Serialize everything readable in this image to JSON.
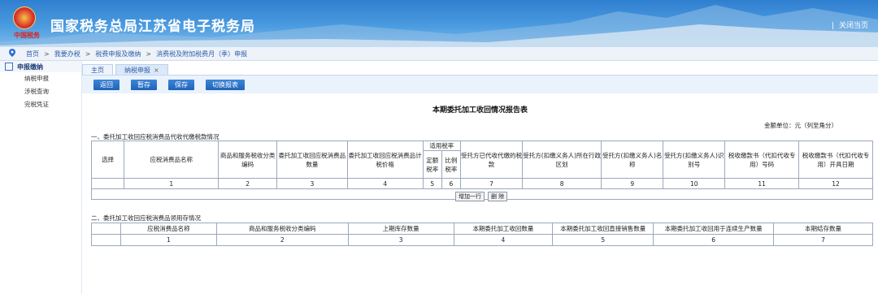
{
  "header": {
    "title": "国家税务总局江苏省电子税务局",
    "emblem_stamp": "中国税务",
    "close_label": "关闭当页",
    "separator": "|"
  },
  "breadcrumb": [
    {
      "label": "首页"
    },
    {
      "label": "我要办税"
    },
    {
      "label": "税费申报及缴纳"
    },
    {
      "label": "消费税及附加税费月（季）申报"
    }
  ],
  "breadcrumb_sep": ">",
  "sidebar": {
    "heading": "申报缴纳",
    "items": [
      {
        "label": "纳税申报"
      },
      {
        "label": "涉税查询"
      },
      {
        "label": "完税凭证"
      }
    ]
  },
  "tabs": [
    {
      "label": "主页",
      "closable": false
    },
    {
      "label": "纳税申报",
      "closable": true,
      "close_mark": "×"
    }
  ],
  "toolbar": {
    "buttons": [
      {
        "label": "返回"
      },
      {
        "label": "暂存"
      },
      {
        "label": "保存"
      },
      {
        "label": "切换报表"
      }
    ]
  },
  "report": {
    "title": "本期委托加工收回情况报告表",
    "unit": "金额单位：元（列至角分）"
  },
  "section1": {
    "title": "一、委托加工收回应税消费品代收代缴税款情况",
    "headers": {
      "select": "选择",
      "c1": "应税消费品名称",
      "c2": "商品和服务税收分类编码",
      "c3": "委托加工收回应税消费品数量",
      "c4": "委托加工收回应税消费品计税价格",
      "rate_group": "适用税率",
      "c5": "定额税率",
      "c6": "比例税率",
      "c7": "受托方已代收代缴的税款",
      "c8": "受托方(扣缴义务人)所在行政区划",
      "c9": "受托方(扣缴义务人)名称",
      "c10": "受托方(扣缴义务人)识别号",
      "c11": "税收缴款书（代扣代收专用）号码",
      "c12": "税收缴款书（代扣代收专用）开具日期"
    },
    "numbers": [
      "1",
      "2",
      "3",
      "4",
      "5",
      "6",
      "7",
      "8",
      "9",
      "10",
      "11",
      "12"
    ],
    "add_row": "增加一行",
    "delete": "删 除"
  },
  "section2": {
    "title": "二、委托加工收回应税消费品领用存情况",
    "headers": [
      "应税消费品名称",
      "商品和服务税收分类编码",
      "上期库存数量",
      "本期委托加工收回数量",
      "本期委托加工收回直接销售数量",
      "本期委托加工收回用于连续生产数量",
      "本期结存数量"
    ],
    "numbers": [
      "1",
      "2",
      "3",
      "4",
      "5",
      "6",
      "7"
    ]
  }
}
